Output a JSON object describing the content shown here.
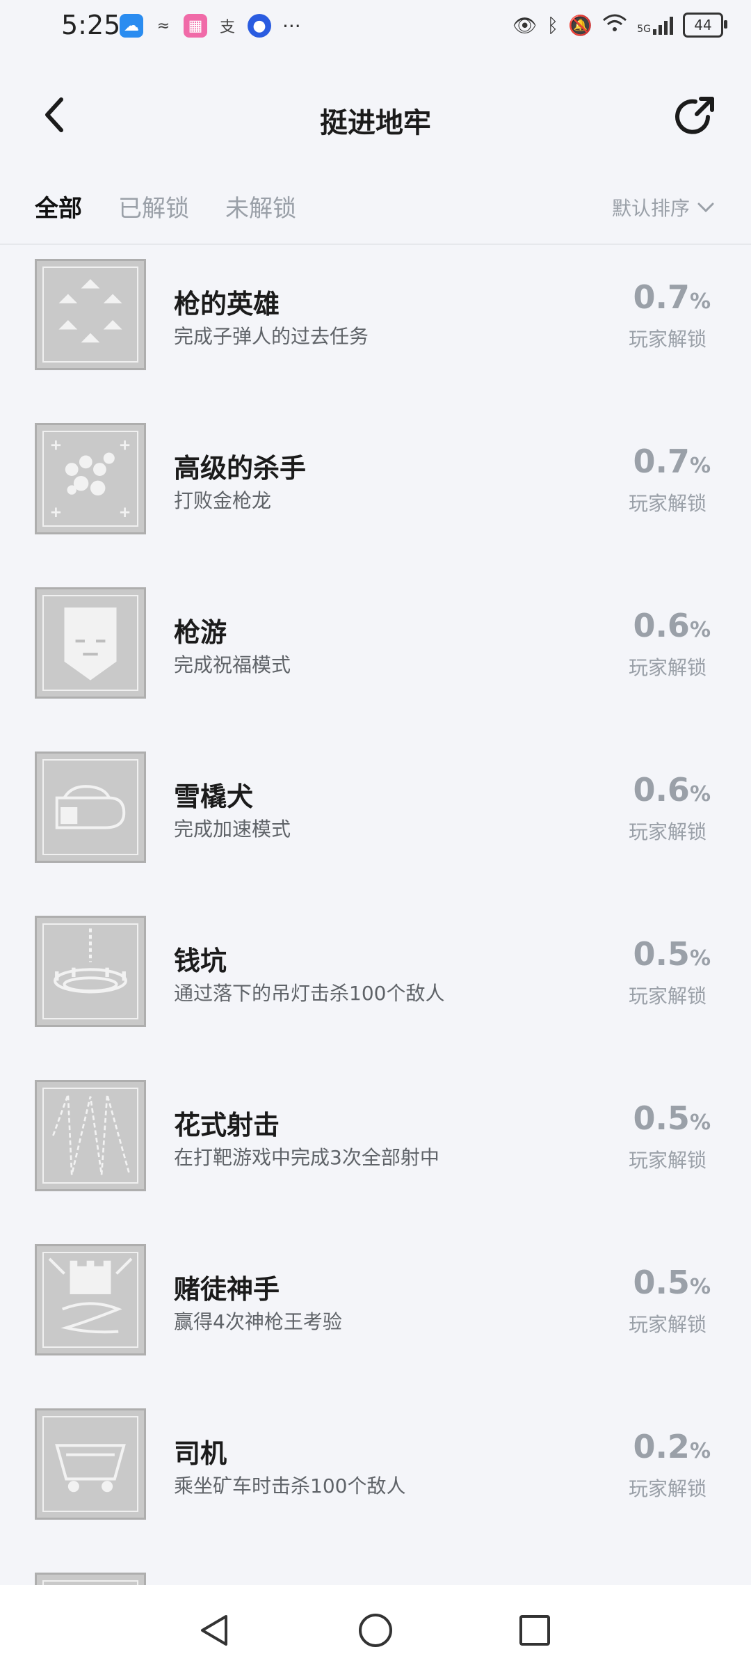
{
  "status_bar": {
    "time": "5:25",
    "battery": "44",
    "signal_label": "5G"
  },
  "header": {
    "title": "挺进地牢"
  },
  "tabs": [
    {
      "label": "全部",
      "active": true
    },
    {
      "label": "已解锁",
      "active": false
    },
    {
      "label": "未解锁",
      "active": false
    }
  ],
  "sort": {
    "label": "默认排序"
  },
  "achievements": [
    {
      "name": "枪的英雄",
      "desc": "完成子弹人的过去任务",
      "percent": "0.7",
      "unit": "%",
      "unlock_label": "玩家解锁",
      "icon": "triangles-icon"
    },
    {
      "name": "高级的杀手",
      "desc": "打败金枪龙",
      "percent": "0.7",
      "unit": "%",
      "unlock_label": "玩家解锁",
      "icon": "dragon-icon"
    },
    {
      "name": "枪游",
      "desc": "完成祝福模式",
      "percent": "0.6",
      "unit": "%",
      "unlock_label": "玩家解锁",
      "icon": "mask-icon"
    },
    {
      "name": "雪橇犬",
      "desc": "完成加速模式",
      "percent": "0.6",
      "unit": "%",
      "unlock_label": "玩家解锁",
      "icon": "boot-icon"
    },
    {
      "name": "钱坑",
      "desc": "通过落下的吊灯击杀100个敌人",
      "percent": "0.5",
      "unit": "%",
      "unlock_label": "玩家解锁",
      "icon": "chandelier-icon"
    },
    {
      "name": "花式射击",
      "desc": "在打靶游戏中完成3次全部射中",
      "percent": "0.5",
      "unit": "%",
      "unlock_label": "玩家解锁",
      "icon": "zigzag-icon"
    },
    {
      "name": "赌徒神手",
      "desc": "赢得4次神枪王考验",
      "percent": "0.5",
      "unit": "%",
      "unlock_label": "玩家解锁",
      "icon": "castle-icon"
    },
    {
      "name": "司机",
      "desc": "乘坐矿车时击杀100个敌人",
      "percent": "0.2",
      "unit": "%",
      "unlock_label": "玩家解锁",
      "icon": "minecart-icon"
    }
  ]
}
